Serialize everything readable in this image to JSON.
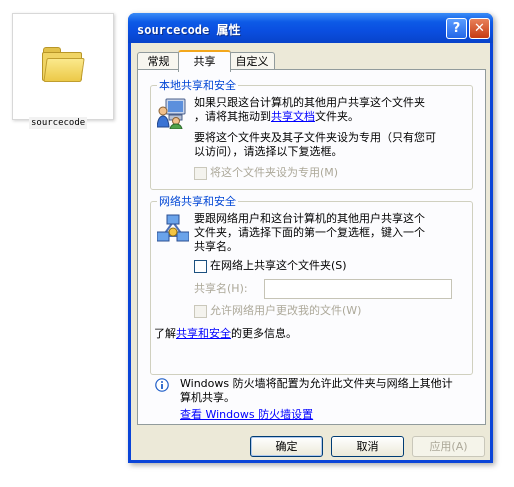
{
  "desktop": {
    "folder_label": "sourcecode",
    "folder_icon": "folder-icon"
  },
  "window": {
    "title": "sourcecode 属性",
    "help_glyph": "?",
    "close_glyph": "✕",
    "tabs": [
      "常规",
      "共享",
      "自定义"
    ],
    "active_tab": "共享"
  },
  "local": {
    "legend": "本地共享和安全",
    "line1": "如果只跟这台计算机的其他用户共享这个文件夹",
    "line2_pre": "，请将其拖动到",
    "line2_link": "共享文档",
    "line2_post": "文件夹。",
    "line3": "要将这个文件夹及其子文件夹设为专用（只有您可",
    "line4": "以访问），请选择以下复选框。",
    "private_checkbox": "将这个文件夹设为专用(M)",
    "icon": "computer-users-icon"
  },
  "network": {
    "legend": "网络共享和安全",
    "line1": "要跟网络用户和这台计算机的其他用户共享这个",
    "line2": "文件夹，请选择下面的第一个复选框，键入一个",
    "line3": "共享名。",
    "share_checkbox": "在网络上共享这个文件夹(S)",
    "share_name_label": "共享名(H):",
    "share_name_value": "",
    "allow_change_checkbox": "允许网络用户更改我的文件(W)",
    "learn_pre": "了解",
    "learn_link": "共享和安全",
    "learn_post": "的更多信息。",
    "icon": "network-share-icon"
  },
  "firewall": {
    "line1": "Windows 防火墙将配置为允许此文件夹与网络上其他计",
    "line2": "算机共享。",
    "link": "查看 Windows 防火墙设置",
    "icon": "info-icon"
  },
  "buttons": {
    "ok": "确定",
    "cancel": "取消",
    "apply": "应用(A)"
  },
  "colors": {
    "titlebar": "#0a4ee0",
    "dialog_bg": "#ece9d8",
    "legend": "#0046d5",
    "link": "#0000ff",
    "active_tab_accent": "#f3a71c"
  }
}
